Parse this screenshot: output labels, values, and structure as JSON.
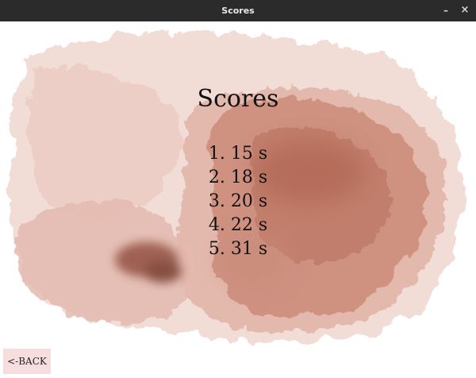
{
  "window": {
    "title": "Scores",
    "minimize_glyph": "–",
    "close_glyph": "×"
  },
  "page": {
    "heading": "Scores",
    "scores": [
      "1. 15 s",
      "2. 18 s",
      "3. 20 s",
      "4. 22 s",
      "5. 31 s"
    ],
    "back_label": "<-BACK"
  },
  "colors": {
    "titlebar": "#2b2b2b",
    "wash_light": "#f1d9d3",
    "wash_mid": "#d9a293",
    "wash_dark": "#b66a56",
    "back_button": "#f7dede"
  }
}
